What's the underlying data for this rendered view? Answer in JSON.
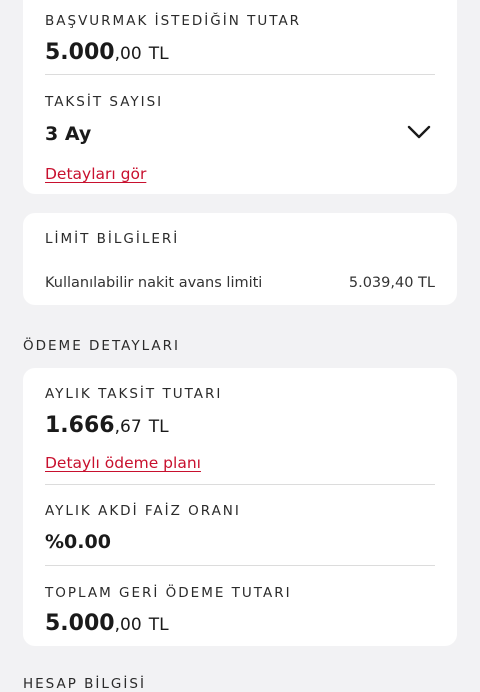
{
  "application": {
    "amount_label": "BAŞVURMAK İSTEDİĞİN TUTAR",
    "amount_int": "5.000",
    "amount_dec": ",00",
    "amount_currency": "TL",
    "installment_label": "TAKSİT SAYISI",
    "installment_value": "3 Ay",
    "details_link": "Detayları gör"
  },
  "limit": {
    "title": "LİMİT BİLGİLERİ",
    "row_label": "Kullanılabilir nakit avans limiti",
    "row_value": "5.039,40 TL"
  },
  "payment": {
    "section_title": "ÖDEME DETAYLARI",
    "monthly_label": "AYLIK TAKSİT TUTARI",
    "monthly_int": "1.666",
    "monthly_dec": ",67",
    "monthly_currency": "TL",
    "plan_link": "Detaylı ödeme planı",
    "rate_label": "AYLIK AKDİ FAİZ ORANI",
    "rate_value": "%0.00",
    "total_label": "TOPLAM GERİ ÖDEME TUTARI",
    "total_int": "5.000",
    "total_dec": ",00",
    "total_currency": "TL"
  },
  "account": {
    "section_title": "HESAP BİLGİSİ"
  },
  "icons": {
    "installment_dropdown": "chevron-down-icon"
  }
}
